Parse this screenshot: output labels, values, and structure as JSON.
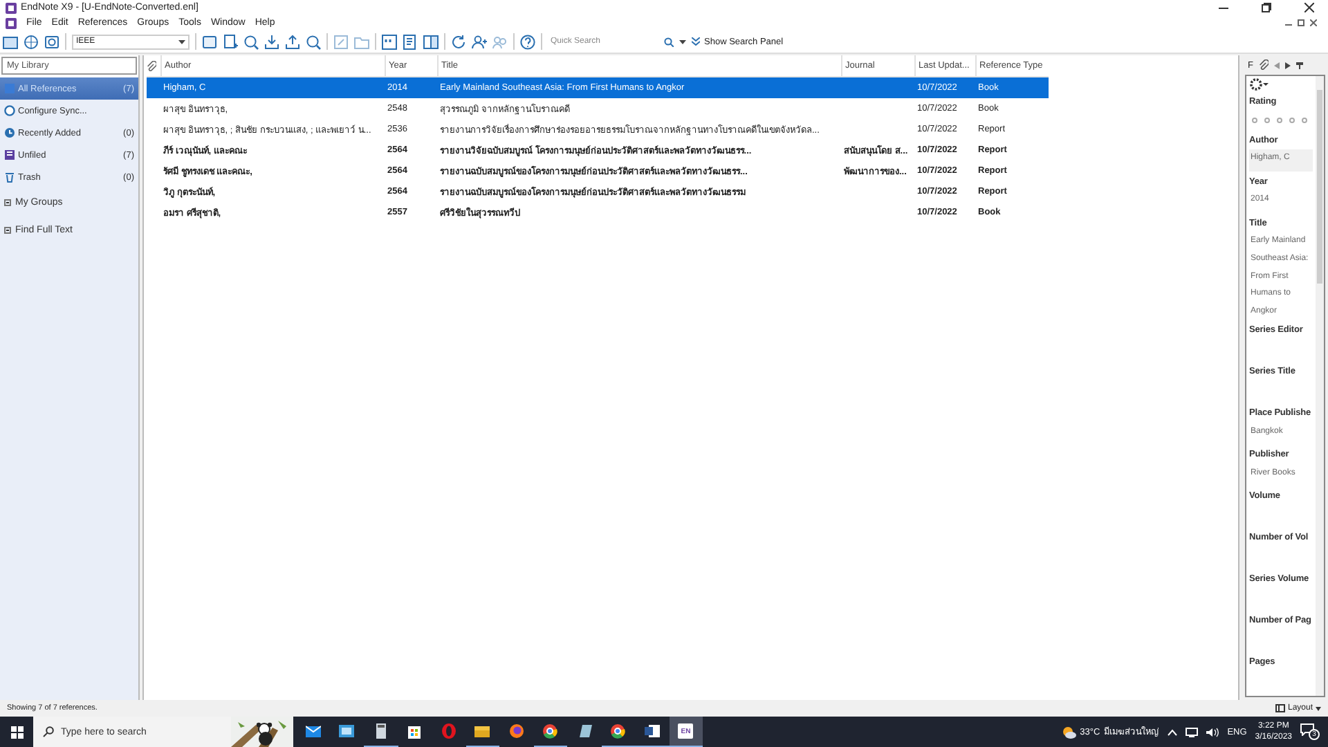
{
  "window": {
    "title": "EndNote X9 - [U-EndNote-Converted.enl]"
  },
  "menu": [
    "File",
    "Edit",
    "References",
    "Groups",
    "Tools",
    "Window",
    "Help"
  ],
  "toolbar": {
    "style": "IEEE",
    "search": {
      "placeholder": "Quick Search"
    },
    "search_panel_label": "Show Search Panel"
  },
  "sidebar": {
    "library_label": "My Library",
    "items": [
      {
        "kind": "all",
        "label": "All References",
        "count": "(7)",
        "selected": true
      },
      {
        "kind": "sync",
        "label": "Configure Sync...",
        "selected": false
      },
      {
        "kind": "recent",
        "label": "Recently Added",
        "count": "(0)",
        "selected": false
      },
      {
        "kind": "unfiled",
        "label": "Unfiled",
        "count": "(7)",
        "selected": false
      },
      {
        "kind": "trash",
        "label": "Trash",
        "count": "(0)",
        "selected": false
      }
    ],
    "groups": [
      {
        "label": "My Groups",
        "expanded": true
      },
      {
        "label": "Find Full Text",
        "expanded": true
      }
    ]
  },
  "table": {
    "columns": [
      "Author",
      "Year",
      "Title",
      "Journal",
      "Last Updat...",
      "Reference Type"
    ],
    "rows": [
      {
        "selected": true,
        "unread": false,
        "cells": [
          "Higham, C",
          "2014",
          "Early Mainland Southeast Asia: From First Humans to Angkor",
          "",
          "10/7/2022",
          "Book"
        ]
      },
      {
        "selected": false,
        "unread": false,
        "cells": [
          "ผาสุข อินทราวุธ,",
          "2548",
          "สุวรรณภูมิ จากหลักฐานโบราณคดี",
          "",
          "10/7/2022",
          "Book"
        ]
      },
      {
        "selected": false,
        "unread": false,
        "cells": [
          "ผาสุข อินทราวุธ, ; สินชัย กระบวนแสง, ; และพเยาว์ น...",
          "2536",
          "รายงานการวิจัยเรื่องการศึกษาร่องรอยอารยธรรมโบราณจากหลักฐานทางโบราณคดีในเขตจังหวัดล...",
          "",
          "10/7/2022",
          "Report"
        ]
      },
      {
        "selected": false,
        "unread": true,
        "cells": [
          "ภีร์ เวณุนันท์, และคณะ",
          "2564",
          "รายงานวิจัยฉบับสมบูรณ์ โครงการมนุษย์ก่อนประวัติศาสตร์และพลวัตทางวัฒนธรร...",
          "สนับสนุนโดย ส...",
          "10/7/2022",
          "Report"
        ]
      },
      {
        "selected": false,
        "unread": true,
        "cells": [
          "รัศมี ชูทรงเดช และคณะ,",
          "2564",
          "รายงานฉบับสมบูรณ์ของโครงการมนุษย์ก่อนประวัติศาสตร์และพลวัตทางวัฒนธรร...",
          "พัฒนาการของ...",
          "10/7/2022",
          "Report"
        ]
      },
      {
        "selected": false,
        "unread": true,
        "cells": [
          "วิภู กุตระนันท์,",
          "2564",
          "รายงานฉบับสมบูรณ์ของโครงการมนุษย์ก่อนประวัติศาสตร์และพลวัตทางวัฒนธรรม",
          "",
          "10/7/2022",
          "Report"
        ]
      },
      {
        "selected": false,
        "unread": true,
        "cells": [
          "อมรา ศรีสุชาติ,",
          "2557",
          "ศรีวิชัยในสุวรรณทวีป",
          "",
          "10/7/2022",
          "Book"
        ]
      }
    ]
  },
  "panel": {
    "tab_label": "F",
    "fields": [
      {
        "kind": "rating",
        "label": "Rating",
        "stars": 0
      },
      {
        "kind": "text",
        "label": "Author",
        "value": "Higham, C",
        "selected": true
      },
      {
        "kind": "text",
        "label": "Year",
        "value": "2014",
        "selected": false
      },
      {
        "kind": "text",
        "label": "Title",
        "value": "Early Mainland Southeast Asia: From First Humans to Angkor",
        "selected": false
      },
      {
        "kind": "text",
        "label": "Series Editor",
        "selected": false
      },
      {
        "kind": "text",
        "label": "Series Title",
        "selected": false
      },
      {
        "kind": "text",
        "label": "Place Publishe",
        "value": "Bangkok",
        "selected": false
      },
      {
        "kind": "text",
        "label": "Publisher",
        "value": "River Books",
        "selected": false
      },
      {
        "kind": "text",
        "label": "Volume",
        "selected": false
      },
      {
        "kind": "text",
        "label": "Number of Vol",
        "selected": false
      },
      {
        "kind": "text",
        "label": "Series Volume",
        "selected": false
      },
      {
        "kind": "text",
        "label": "Number of Pag",
        "selected": false
      },
      {
        "kind": "text",
        "label": "Pages",
        "selected": false
      }
    ]
  },
  "status_bar": {
    "text": "Showing 7 of 7 references.",
    "layout_label": "Layout"
  },
  "taskbar": {
    "search": {
      "placeholder": "Type here to search"
    },
    "apps": [
      {
        "kind": "mail",
        "running": false,
        "selected": false
      },
      {
        "kind": "photos",
        "running": false,
        "selected": false
      },
      {
        "kind": "calculator",
        "running": true,
        "selected": false
      },
      {
        "kind": "store",
        "running": false,
        "selected": false
      },
      {
        "kind": "opera",
        "running": false,
        "selected": false
      },
      {
        "kind": "files",
        "running": true,
        "selected": false
      },
      {
        "kind": "firefox",
        "running": false,
        "selected": false
      },
      {
        "kind": "chrome",
        "running": true,
        "selected": false
      },
      {
        "kind": "notes",
        "running": false,
        "selected": false
      },
      {
        "kind": "chrome",
        "running": true,
        "selected": false
      },
      {
        "kind": "word",
        "running": true,
        "selected": false
      },
      {
        "kind": "endnote",
        "label": "EN",
        "running": true,
        "selected": true
      }
    ],
    "weather": {
      "temp": "33°C",
      "condition": "มีเมฆส่วนใหญ่"
    },
    "language": "ENG",
    "time": "3:22 PM",
    "date": "3/16/2023",
    "notifications": "3"
  }
}
